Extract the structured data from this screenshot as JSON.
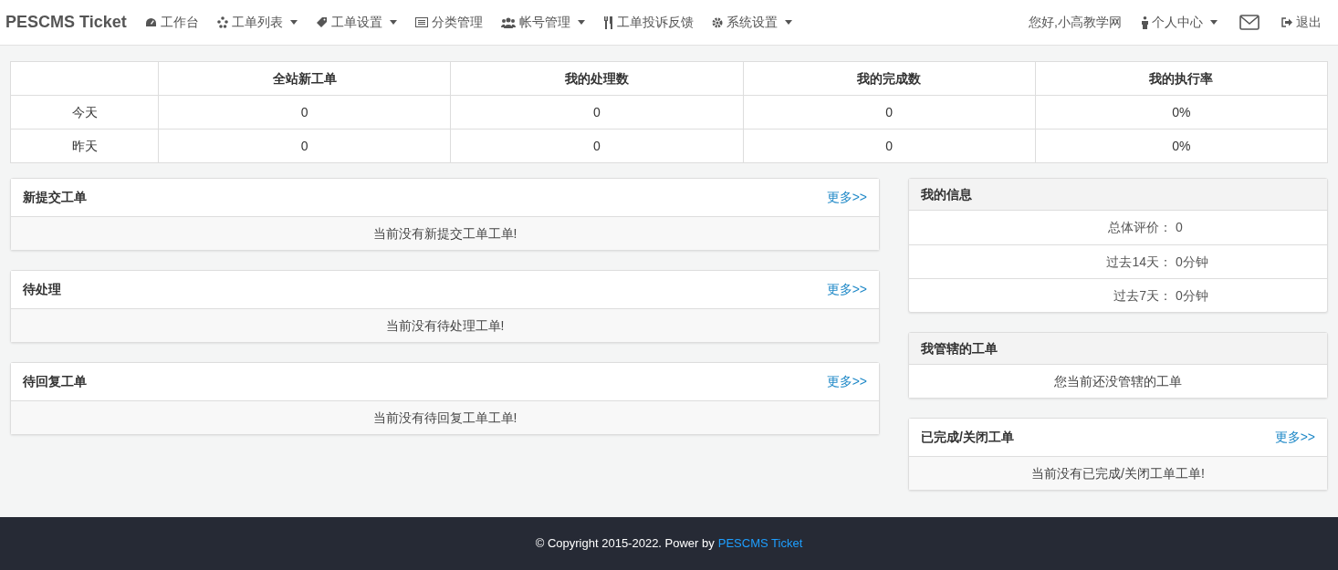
{
  "navbar": {
    "brand": "PESCMS Ticket",
    "menu": [
      {
        "label": "工作台",
        "dropdown": false
      },
      {
        "label": "工单列表",
        "dropdown": true
      },
      {
        "label": "工单设置",
        "dropdown": true
      },
      {
        "label": "分类管理",
        "dropdown": false
      },
      {
        "label": "帐号管理",
        "dropdown": true
      },
      {
        "label": "工单投诉反馈",
        "dropdown": false
      },
      {
        "label": "系统设置",
        "dropdown": true
      }
    ],
    "greeting": "您好,小高教学网",
    "right": [
      {
        "label": "个人中心",
        "dropdown": true
      },
      {
        "dropdown": false
      },
      {
        "label": "退出",
        "dropdown": false
      }
    ]
  },
  "stats": {
    "columns": [
      "",
      "全站新工单",
      "我的处理数",
      "我的完成数",
      "我的执行率"
    ],
    "rows": [
      [
        "今天",
        "0",
        "0",
        "0",
        "0%"
      ],
      [
        "昨天",
        "0",
        "0",
        "0",
        "0%"
      ]
    ]
  },
  "left_panels": [
    {
      "kind": "list",
      "title": "新提交工单",
      "more": "更多>>",
      "empty": "当前没有新提交工单工单!"
    },
    {
      "kind": "list",
      "title": "待处理",
      "more": "更多>>",
      "empty": "当前没有待处理工单!"
    },
    {
      "kind": "list",
      "title": "待回复工单",
      "more": "更多>>",
      "empty": "当前没有待回复工单工单!"
    }
  ],
  "right_panels": [
    {
      "kind": "info",
      "title": "我的信息",
      "rows": [
        {
          "label": "总体评价：",
          "value": "0"
        },
        {
          "label": "过去14天：",
          "value": "0分钟"
        },
        {
          "label": "过去7天：",
          "value": "0分钟"
        }
      ]
    },
    {
      "kind": "message",
      "title": "我管辖的工单",
      "empty": "您当前还没管辖的工单"
    },
    {
      "kind": "list",
      "title": "已完成/关闭工单",
      "more": "更多>>",
      "empty": "当前没有已完成/关闭工单工单!"
    }
  ],
  "footer": {
    "text": "© Copyright 2015-2022. Power by",
    "link": "PESCMS Ticket"
  }
}
